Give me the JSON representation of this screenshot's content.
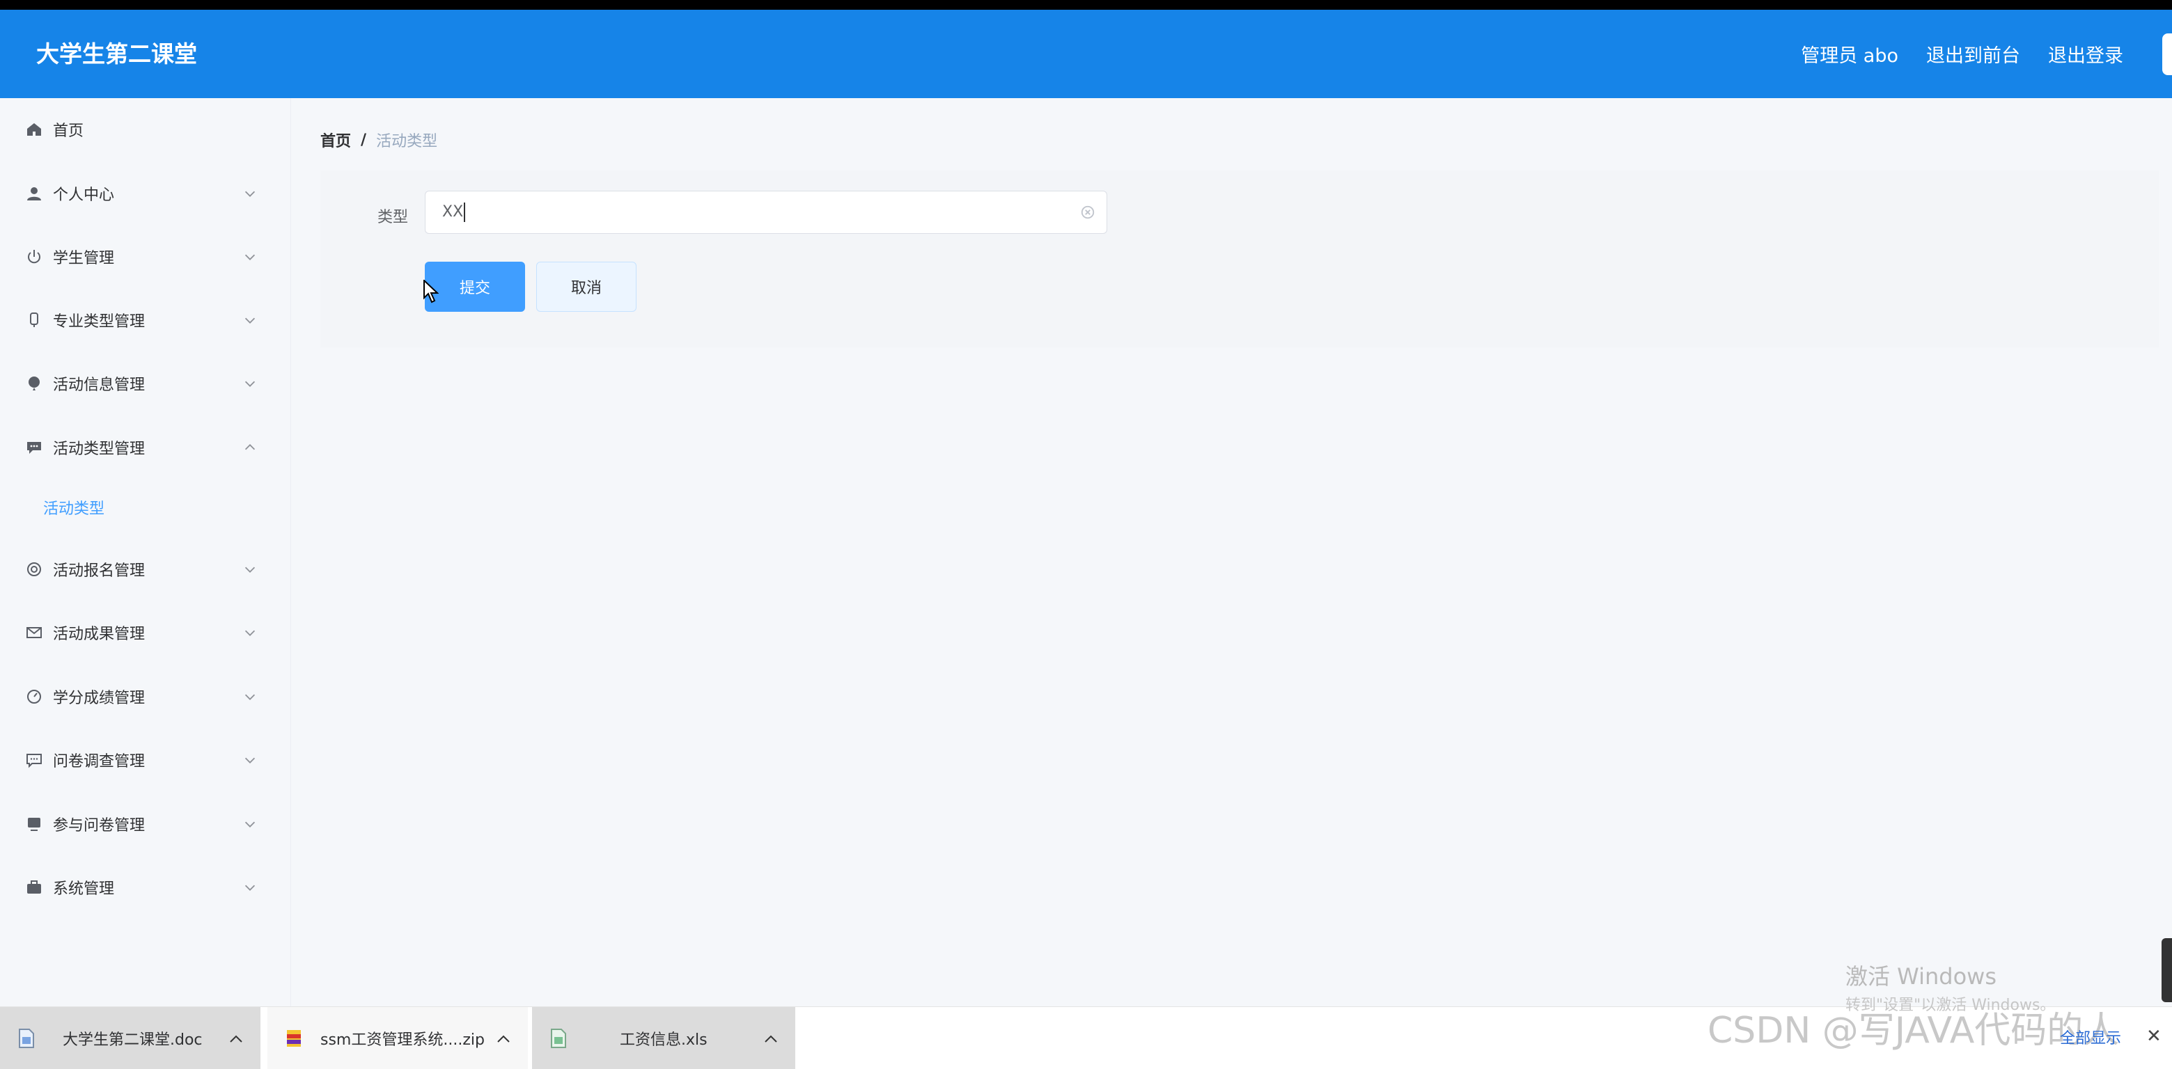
{
  "header": {
    "brand": "大学生第二课堂",
    "user": "管理员 abo",
    "to_front": "退出到前台",
    "logout": "退出登录"
  },
  "sidebar": {
    "items": [
      {
        "label": "首页",
        "icon": "home-icon"
      },
      {
        "label": "个人中心",
        "icon": "user-icon"
      },
      {
        "label": "学生管理",
        "icon": "power-icon"
      },
      {
        "label": "专业类型管理",
        "icon": "microphone-icon"
      },
      {
        "label": "活动信息管理",
        "icon": "balloon-icon"
      },
      {
        "label": "活动类型管理",
        "icon": "chat-icon"
      },
      {
        "label": "活动报名管理",
        "icon": "lifebuoy-icon"
      },
      {
        "label": "活动成果管理",
        "icon": "mail-icon"
      },
      {
        "label": "学分成绩管理",
        "icon": "gauge-icon"
      },
      {
        "label": "问卷调查管理",
        "icon": "message-icon"
      },
      {
        "label": "参与问卷管理",
        "icon": "monitor-icon"
      },
      {
        "label": "系统管理",
        "icon": "briefcase-icon"
      }
    ],
    "active_sub": "活动类型"
  },
  "breadcrumb": {
    "home": "首页",
    "sep": "/",
    "current": "活动类型"
  },
  "form": {
    "label": "类型",
    "value": "XX",
    "submit": "提交",
    "cancel": "取消"
  },
  "downloads": [
    {
      "name": "大学生第二课堂.doc"
    },
    {
      "name": "ssm工资管理系统....zip"
    },
    {
      "name": "工资信息.xls"
    }
  ],
  "overlay": {
    "win_title": "激活 Windows",
    "win_sub": "转到\"设置\"以激活 Windows。",
    "watermark": "CSDN @写JAVA代码的人",
    "show_all": "全部显示",
    "close": "✕"
  },
  "colors": {
    "header": "#1684e8",
    "primary": "#409eff",
    "page": "#f5f7fa"
  }
}
